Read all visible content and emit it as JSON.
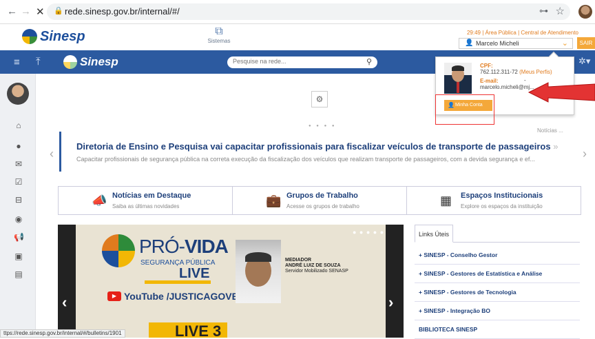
{
  "browser": {
    "back": "←",
    "forward": "→",
    "close": "✕",
    "url": "rede.sinesp.gov.br/internal/#/",
    "status_url": "ttps://rede.sinesp.gov.br/internal/#/bulletins/1901"
  },
  "header": {
    "logo_text": "Sinesp",
    "sistemas_label": "Sistemas",
    "top_links": "29:49 | Área Pública | Central de Atendimento",
    "user_name": "Marcelo Micheli",
    "sair_label": "SAIR"
  },
  "nav": {
    "logo_text": "Sinesp",
    "search_placeholder": "Pesquise na rede..."
  },
  "profile_dropdown": {
    "cpf_label": "CPF:",
    "cpf_value": "762.112.311-72",
    "perfis_link": "(Meus Perfis)",
    "email_label": "E-mail:",
    "email_dash": "-",
    "email_value": "marcelo.micheli@mj...",
    "button_label": "Minha Conta"
  },
  "news": {
    "hidden_label": "Notícias ...",
    "title": "Diretoria de Ensino e Pesquisa vai capacitar profissionais para fiscalizar veículos de transporte de passageiros",
    "title_more": "»",
    "subtitle": "Capacitar profissionais de segurança pública na correta execução da fiscalização dos veículos que realizam transporte de passageiros, com a devida segurança e ef..."
  },
  "quicklinks": [
    {
      "title": "Notícias em Destaque",
      "subtitle": "Saiba as últimas novidades"
    },
    {
      "title": "Grupos de Trabalho",
      "subtitle": "Acesse os grupos de trabalho"
    },
    {
      "title": "Espaços Institucionais",
      "subtitle": "Explore os espaços da instituição"
    }
  ],
  "banner": {
    "title_a": "PRÓ-",
    "title_b": "VIDA",
    "subtitle": "SEGURANÇA PÚBLICA",
    "live": "LIVE",
    "youtube": "YouTube /JUSTICAGOVBR",
    "mediator_label": "MEDIADOR",
    "mediator_name": "ANDRÉ LUIZ DE SOUZA",
    "mediator_role": "Servidor Mobilizado SENASP",
    "live3": "LIVE 3"
  },
  "links": {
    "tab_label": "Links Úteis",
    "items": [
      "+ SINESP - Conselho Gestor",
      "+ SINESP - Gestores de Estatística e Análise",
      "+ SINESP - Gestores de Tecnologia",
      "+ SINESP - Integração BO",
      "BIBLIOTECA SINESP"
    ]
  },
  "colors": {
    "nav_blue": "#2c5aa0",
    "accent_orange": "#f4a83a",
    "highlight_red": "#e33333"
  }
}
